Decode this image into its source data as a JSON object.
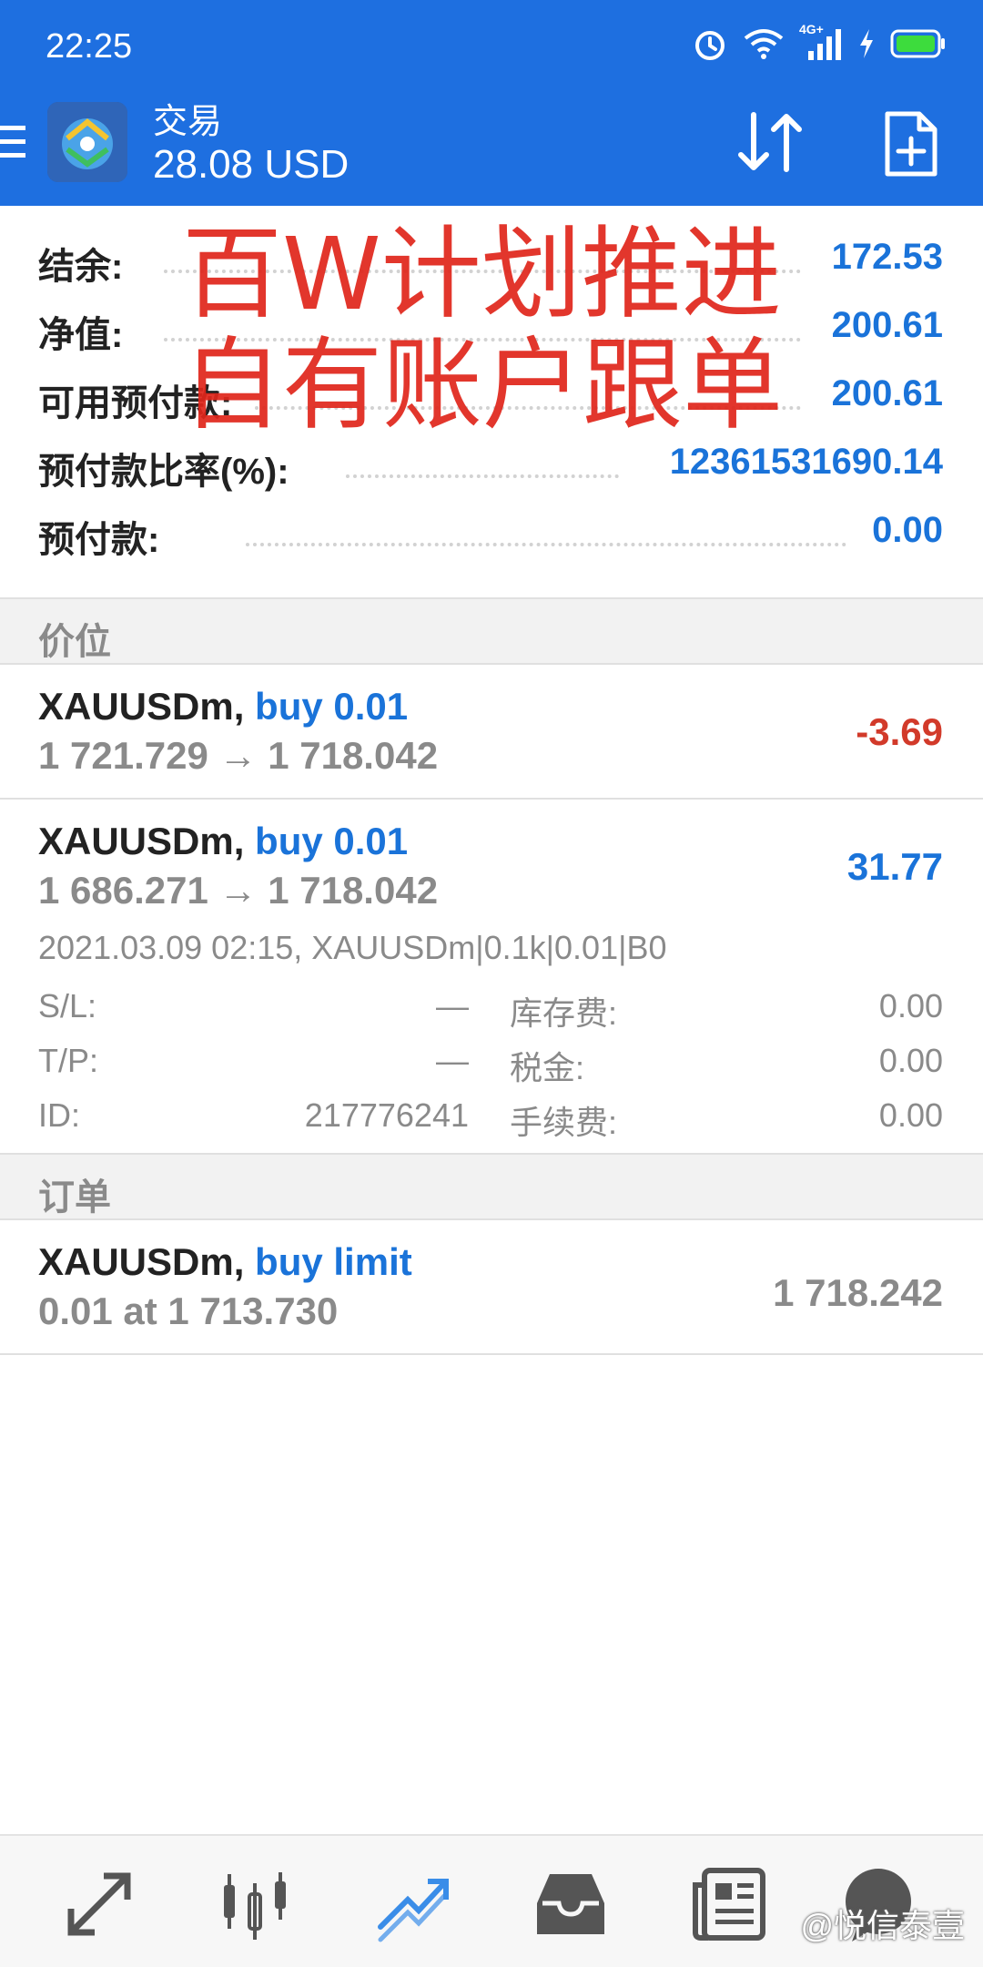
{
  "status_bar": {
    "time": "22:25",
    "network": "4G+",
    "icons": [
      "alarm-icon",
      "wifi-icon",
      "signal-icon",
      "charging-icon",
      "battery-icon"
    ]
  },
  "appbar": {
    "title": "交易",
    "balance_display": "28.08 USD",
    "icons": [
      "menu-icon",
      "sort-icon",
      "new-order-icon"
    ]
  },
  "summary": {
    "rows": [
      {
        "label": "结余:",
        "value": "172.53"
      },
      {
        "label": "净值:",
        "value": "200.61"
      },
      {
        "label": "可用预付款:",
        "value": "200.61"
      },
      {
        "label": "预付款比率(%):",
        "value": "12361531690.14"
      },
      {
        "label": "预付款:",
        "value": "0.00"
      }
    ]
  },
  "watermark": {
    "line1": "百W计划推进",
    "line2": "自有账户跟单"
  },
  "positions": {
    "header": "价位",
    "items": [
      {
        "symbol": "XAUUSDm,",
        "side": "buy 0.01",
        "open_price": "1 721.729",
        "arrow": "→",
        "current_price": "1 718.042",
        "profit": "-3.69"
      },
      {
        "symbol": "XAUUSDm,",
        "side": "buy 0.01",
        "open_price": "1 686.271",
        "arrow": "→",
        "current_price": "1 718.042",
        "profit": "31.77",
        "meta": "2021.03.09 02:15, XAUUSDm|0.1k|0.01|B0",
        "details": {
          "sl_label": "S/L:",
          "sl_value": "—",
          "tp_label": "T/P:",
          "tp_value": "—",
          "id_label": "ID:",
          "id_value": "217776241",
          "swap_label": "库存费:",
          "swap_value": "0.00",
          "tax_label": "税金:",
          "tax_value": "0.00",
          "commission_label": "手续费:",
          "commission_value": "0.00"
        }
      }
    ]
  },
  "orders": {
    "header": "订单",
    "items": [
      {
        "symbol": "XAUUSDm,",
        "side": "buy limit",
        "volume_price": "0.01 at 1 713.730",
        "current_price": "1 718.242"
      }
    ]
  },
  "bottom_nav": {
    "items": [
      "quotes-icon",
      "chart-icon",
      "trade-icon",
      "history-icon",
      "news-icon",
      "chat-icon"
    ],
    "active": "trade-icon",
    "brand": "@悦信泰壹"
  },
  "colors": {
    "header_blue": "#1e6fe0",
    "value_blue": "#1a73d9",
    "loss_red": "#d23a2a",
    "watermark_red": "#e0261b"
  }
}
